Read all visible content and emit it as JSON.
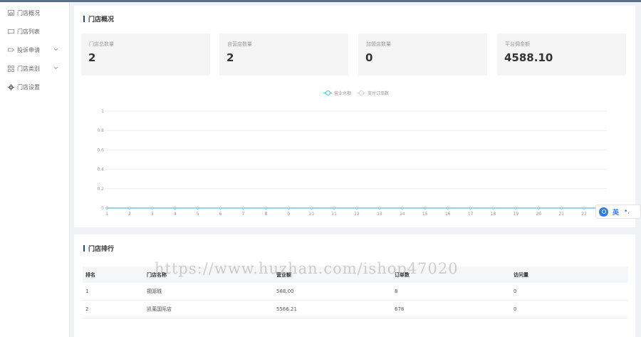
{
  "sidebar": {
    "items": [
      {
        "label": "门店概况",
        "icon": "bar-chart-icon"
      },
      {
        "label": "门店列表",
        "icon": "store-list-icon"
      },
      {
        "label": "投诉申请",
        "icon": "complaint-icon",
        "expandable": true
      },
      {
        "label": "门店类别",
        "icon": "category-grid-icon",
        "expandable": true
      },
      {
        "label": "门店设置",
        "icon": "gear-icon"
      }
    ]
  },
  "overview": {
    "title": "门店概况",
    "stats": [
      {
        "label": "门店总数量",
        "value": "2"
      },
      {
        "label": "自营店数量",
        "value": "2"
      },
      {
        "label": "加盟店数量",
        "value": "0"
      },
      {
        "label": "平台佣金额",
        "value": "4588.10"
      }
    ]
  },
  "chart_data": {
    "type": "line",
    "x": [
      1,
      2,
      3,
      4,
      5,
      6,
      7,
      8,
      9,
      10,
      11,
      12,
      13,
      14,
      15,
      16,
      17,
      18,
      19,
      20,
      21,
      22,
      23
    ],
    "yticks": [
      "0",
      "0.2",
      "0.4",
      "0.6",
      "0.8",
      "1"
    ],
    "ylim": [
      0,
      1
    ],
    "series": [
      {
        "name": "营业总额",
        "color": "#5bc0de",
        "values": [
          0,
          0,
          0,
          0,
          0,
          0,
          0,
          0,
          0,
          0,
          0,
          0,
          0,
          0,
          0,
          0,
          0,
          0,
          0,
          0,
          0,
          0,
          0
        ]
      },
      {
        "name": "支付订单数",
        "color": "#c8d5e8",
        "values": [
          0,
          0,
          0,
          0,
          0,
          0,
          0,
          0,
          0,
          0,
          0,
          0,
          0,
          0,
          0,
          0,
          0,
          0,
          0,
          0,
          0,
          0,
          0
        ]
      }
    ],
    "legend_position": "top-center",
    "grid": true
  },
  "ranking": {
    "title": "门店排行",
    "columns": [
      "排名",
      "门店名称",
      "营业额",
      "订单数",
      "访问量"
    ],
    "rows": [
      [
        "1",
        "钢源城",
        "588.00",
        "8",
        "0"
      ],
      [
        "2",
        "凯莱国际店",
        "5566.21",
        "678",
        "0"
      ]
    ]
  },
  "ime": {
    "lang": "英",
    "dots": "•,"
  },
  "watermark": "https://www.huzhan.com/ishop47020",
  "colors": {
    "accent": "#1d4e89",
    "line": "#5bc0de"
  }
}
